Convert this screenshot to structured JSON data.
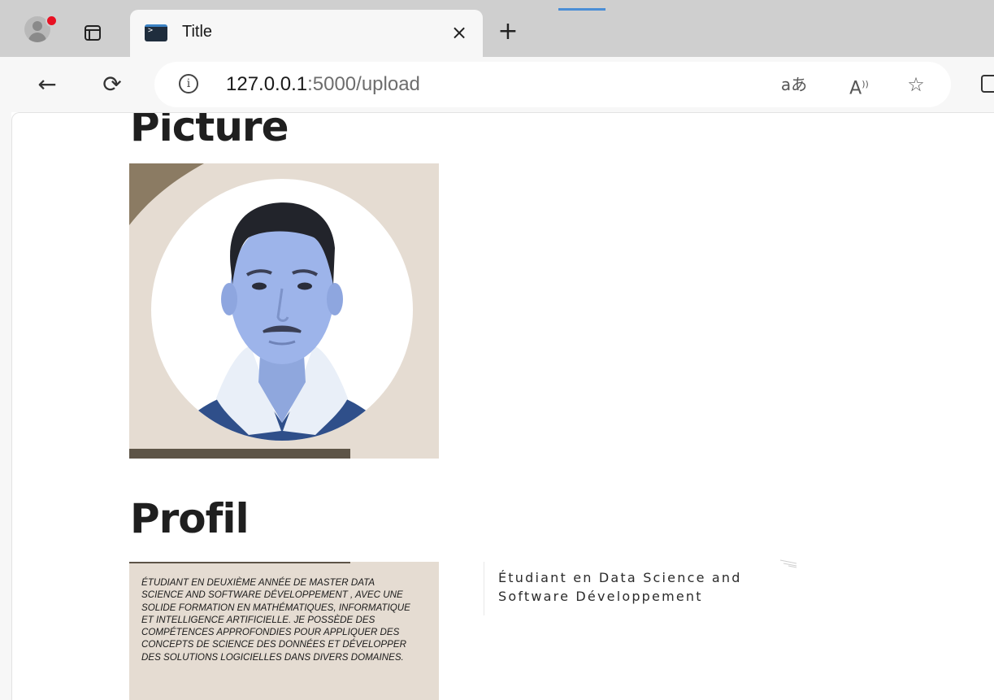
{
  "browser": {
    "tab": {
      "title": "Title",
      "close_glyph": "×"
    },
    "new_tab_glyph": "+",
    "address": {
      "host": "127.0.0.1",
      "rest": ":5000/upload"
    },
    "icons": {
      "back": "←",
      "reload": "⟳",
      "info": "i",
      "translate": "aあ",
      "read_aloud": "A⁾",
      "favorite": "☆"
    }
  },
  "page": {
    "picture_heading": "Picture",
    "profil_heading": "Profil",
    "profile_text": "Étudiant en deuxième année de master Data Science and Software développement , avec une solide formation en mathématiques, informatique et intelligence artificielle. Je possède des compétences approfondies pour appliquer des concepts de science des données et développer des solutions logicielles dans divers domaines.",
    "subtitle": "Étudiant en Data Science and Software Développement"
  },
  "colors": {
    "card_bg": "#e5dcd2",
    "accent_dark": "#5d5447",
    "wave": "#8b7b63"
  }
}
